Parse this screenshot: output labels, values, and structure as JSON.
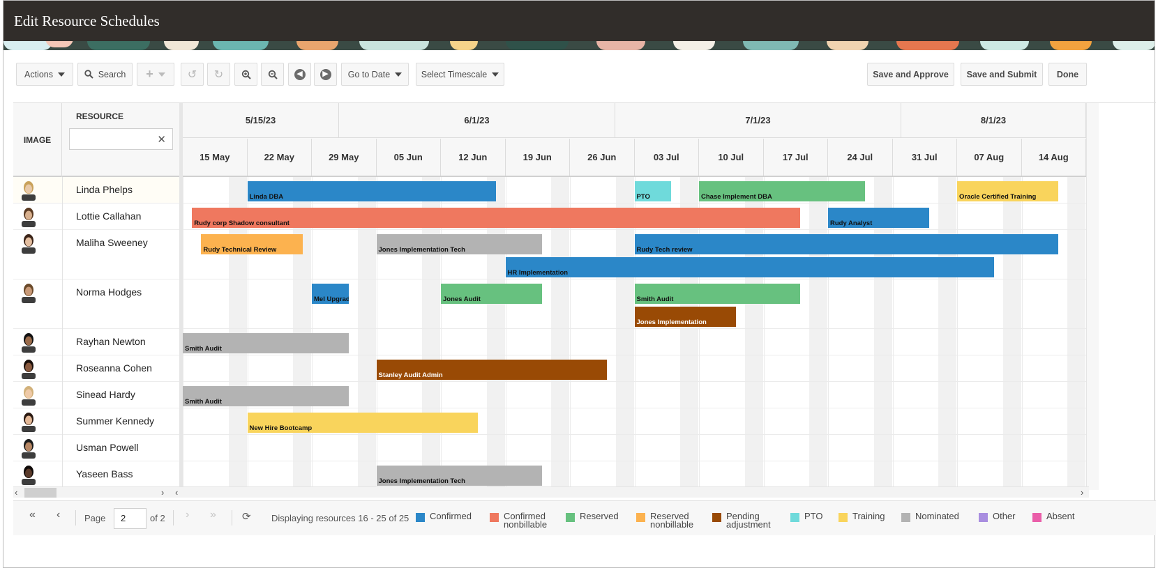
{
  "window": {
    "title": "Edit Resource Schedules"
  },
  "toolbar": {
    "actions_label": "Actions",
    "search_label": "Search",
    "goto_date_label": "Go to Date",
    "select_timescale_label": "Select Timescale",
    "save_approve_label": "Save and Approve",
    "save_submit_label": "Save and Submit",
    "done_label": "Done"
  },
  "grid": {
    "image_header": "IMAGE",
    "resource_header": "RESOURCE",
    "resource_filter_value": "",
    "months": [
      "5/15/23",
      "6/1/23",
      "7/1/23",
      "8/1/23"
    ],
    "weeks": [
      "15 May",
      "22 May",
      "29 May",
      "05 Jun",
      "12 Jun",
      "19 Jun",
      "26 Jun",
      "03 Jul",
      "10 Jul",
      "17 Jul",
      "24 Jul",
      "31 Jul",
      "07 Aug",
      "14 Aug"
    ]
  },
  "resources": [
    {
      "name": "Linda Phelps",
      "events": [
        {
          "label": "Linda DBA",
          "start": "2023-05-22",
          "end": "2023-06-18",
          "status": "confirmed"
        },
        {
          "label": "PTO",
          "start": "2023-07-03",
          "end": "2023-07-07",
          "status": "pto"
        },
        {
          "label": "Chase Implement DBA",
          "start": "2023-07-10",
          "end": "2023-07-28",
          "status": "reserved"
        },
        {
          "label": "Oracle Certified Training",
          "start": "2023-08-07",
          "end": "2023-08-18",
          "status": "training"
        }
      ]
    },
    {
      "name": "Lottie Callahan",
      "events": [
        {
          "label": "Rudy corp Shadow consultant",
          "start": "2023-05-16",
          "end": "2023-07-21",
          "status": "confirmed_nonbillable"
        },
        {
          "label": "Rudy Analyst",
          "start": "2023-07-24",
          "end": "2023-08-04",
          "status": "confirmed"
        }
      ]
    },
    {
      "name": "Maliha Sweeney",
      "events": [
        {
          "label": "Rudy Technical Review",
          "start": "2023-05-17",
          "end": "2023-05-28",
          "status": "reserved_nonbillable"
        },
        {
          "label": "Jones Implementation Tech",
          "start": "2023-06-05",
          "end": "2023-06-23",
          "status": "nominated"
        },
        {
          "label": "Rudy Tech review",
          "start": "2023-07-03",
          "end": "2023-08-18",
          "status": "confirmed"
        },
        {
          "label": "HR Implementation",
          "start": "2023-06-19",
          "end": "2023-08-11",
          "status": "confirmed"
        }
      ]
    },
    {
      "name": "Norma Hodges",
      "events": [
        {
          "label": "Mel Upgrade",
          "start": "2023-05-29",
          "end": "2023-06-02",
          "status": "confirmed"
        },
        {
          "label": "Jones Audit",
          "start": "2023-06-12",
          "end": "2023-06-23",
          "status": "reserved"
        },
        {
          "label": "Smith Audit",
          "start": "2023-07-03",
          "end": "2023-07-21",
          "status": "reserved"
        },
        {
          "label": "Jones Implementation",
          "start": "2023-07-03",
          "end": "2023-07-14",
          "status": "pending_adjustment"
        }
      ]
    },
    {
      "name": "Rayhan Newton",
      "events": [
        {
          "label": "Smith Audit",
          "start": "2023-05-15",
          "end": "2023-06-02",
          "status": "nominated"
        }
      ]
    },
    {
      "name": "Roseanna Cohen",
      "events": [
        {
          "label": "Stanley Audit Admin",
          "start": "2023-06-05",
          "end": "2023-06-30",
          "status": "pending_adjustment"
        }
      ]
    },
    {
      "name": "Sinead Hardy",
      "events": [
        {
          "label": "Smith Audit",
          "start": "2023-05-15",
          "end": "2023-06-02",
          "status": "nominated"
        }
      ]
    },
    {
      "name": "Summer Kennedy",
      "events": [
        {
          "label": "New Hire Bootcamp",
          "start": "2023-05-22",
          "end": "2023-06-16",
          "status": "training"
        }
      ]
    },
    {
      "name": "Usman Powell",
      "events": []
    },
    {
      "name": "Yaseen Bass",
      "events": [
        {
          "label": "Jones Implementation Tech",
          "start": "2023-06-05",
          "end": "2023-06-23",
          "status": "nominated"
        }
      ]
    }
  ],
  "pager": {
    "page_label": "Page",
    "page_value": "2",
    "of_label": "of 2",
    "display_text": "Displaying resources 16 - 25 of 25"
  },
  "legend": [
    {
      "key": "confirmed",
      "line1": "Confirmed",
      "line2": "",
      "color": "#2b87c8"
    },
    {
      "key": "confirmed_nonbillable",
      "line1": "Confirmed",
      "line2": "nonbillable",
      "color": "#ef785f"
    },
    {
      "key": "reserved",
      "line1": "Reserved",
      "line2": "",
      "color": "#67c17f"
    },
    {
      "key": "reserved_nonbillable",
      "line1": "Reserved",
      "line2": "nonbillable",
      "color": "#fcb24f"
    },
    {
      "key": "pending_adjustment",
      "line1": "Pending",
      "line2": "adjustment",
      "color": "#994a05"
    },
    {
      "key": "pto",
      "line1": "PTO",
      "line2": "",
      "color": "#6fdadb"
    },
    {
      "key": "training",
      "line1": "Training",
      "line2": "",
      "color": "#f9d45c"
    },
    {
      "key": "nominated",
      "line1": "Nominated",
      "line2": "",
      "color": "#b3b3b3"
    },
    {
      "key": "other",
      "line1": "Other",
      "line2": "",
      "color": "#a98ee0"
    },
    {
      "key": "absent",
      "line1": "Absent",
      "line2": "",
      "color": "#ea5ea9"
    }
  ],
  "icons": {
    "search": "search-icon",
    "add": "plus-icon",
    "undo": "undo-icon",
    "redo": "redo-icon",
    "zoom_in": "zoom-in-icon",
    "zoom_out": "zoom-out-icon",
    "prev": "arrow-left-circle-icon",
    "next": "arrow-right-circle-icon",
    "clear": "close-icon",
    "refresh": "refresh-icon"
  }
}
